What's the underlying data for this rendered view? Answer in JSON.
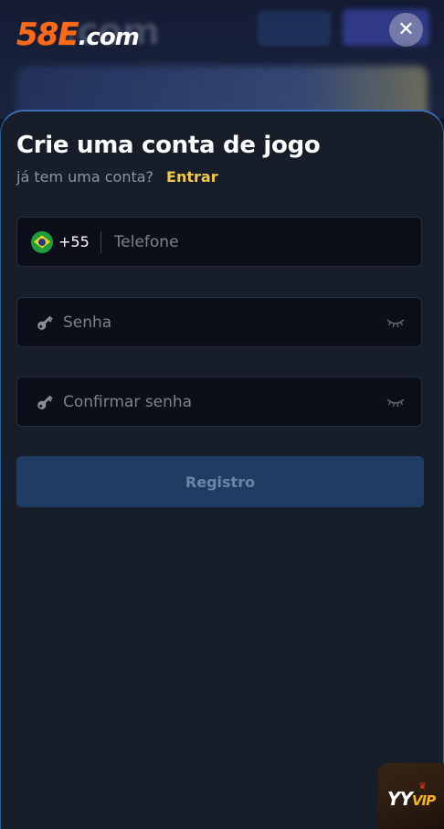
{
  "header": {
    "logo_number": "58E",
    "logo_domain": ".com",
    "close_symbol": "✕"
  },
  "modal": {
    "title": "Crie uma conta de jogo",
    "subtitle": "já tem uma conta?",
    "login_link": "Entrar",
    "phone": {
      "country_flag": "brazil-flag-icon",
      "dial_code": "+55",
      "placeholder": "Telefone",
      "value": ""
    },
    "password": {
      "placeholder": "Senha",
      "value": ""
    },
    "confirm_password": {
      "placeholder": "Confirmar senha",
      "value": ""
    },
    "register_button": "Registro"
  },
  "vip_badge": {
    "brand": "YY",
    "accent": "VIP"
  },
  "colors": {
    "accent_logo": "#ff6a1a",
    "link": "#f2c94c",
    "sheet_bg": "#181d2a",
    "field_bg": "#0c0f1a",
    "button_bg": "#1f3d63",
    "sheet_border": "#3a6fb5"
  }
}
